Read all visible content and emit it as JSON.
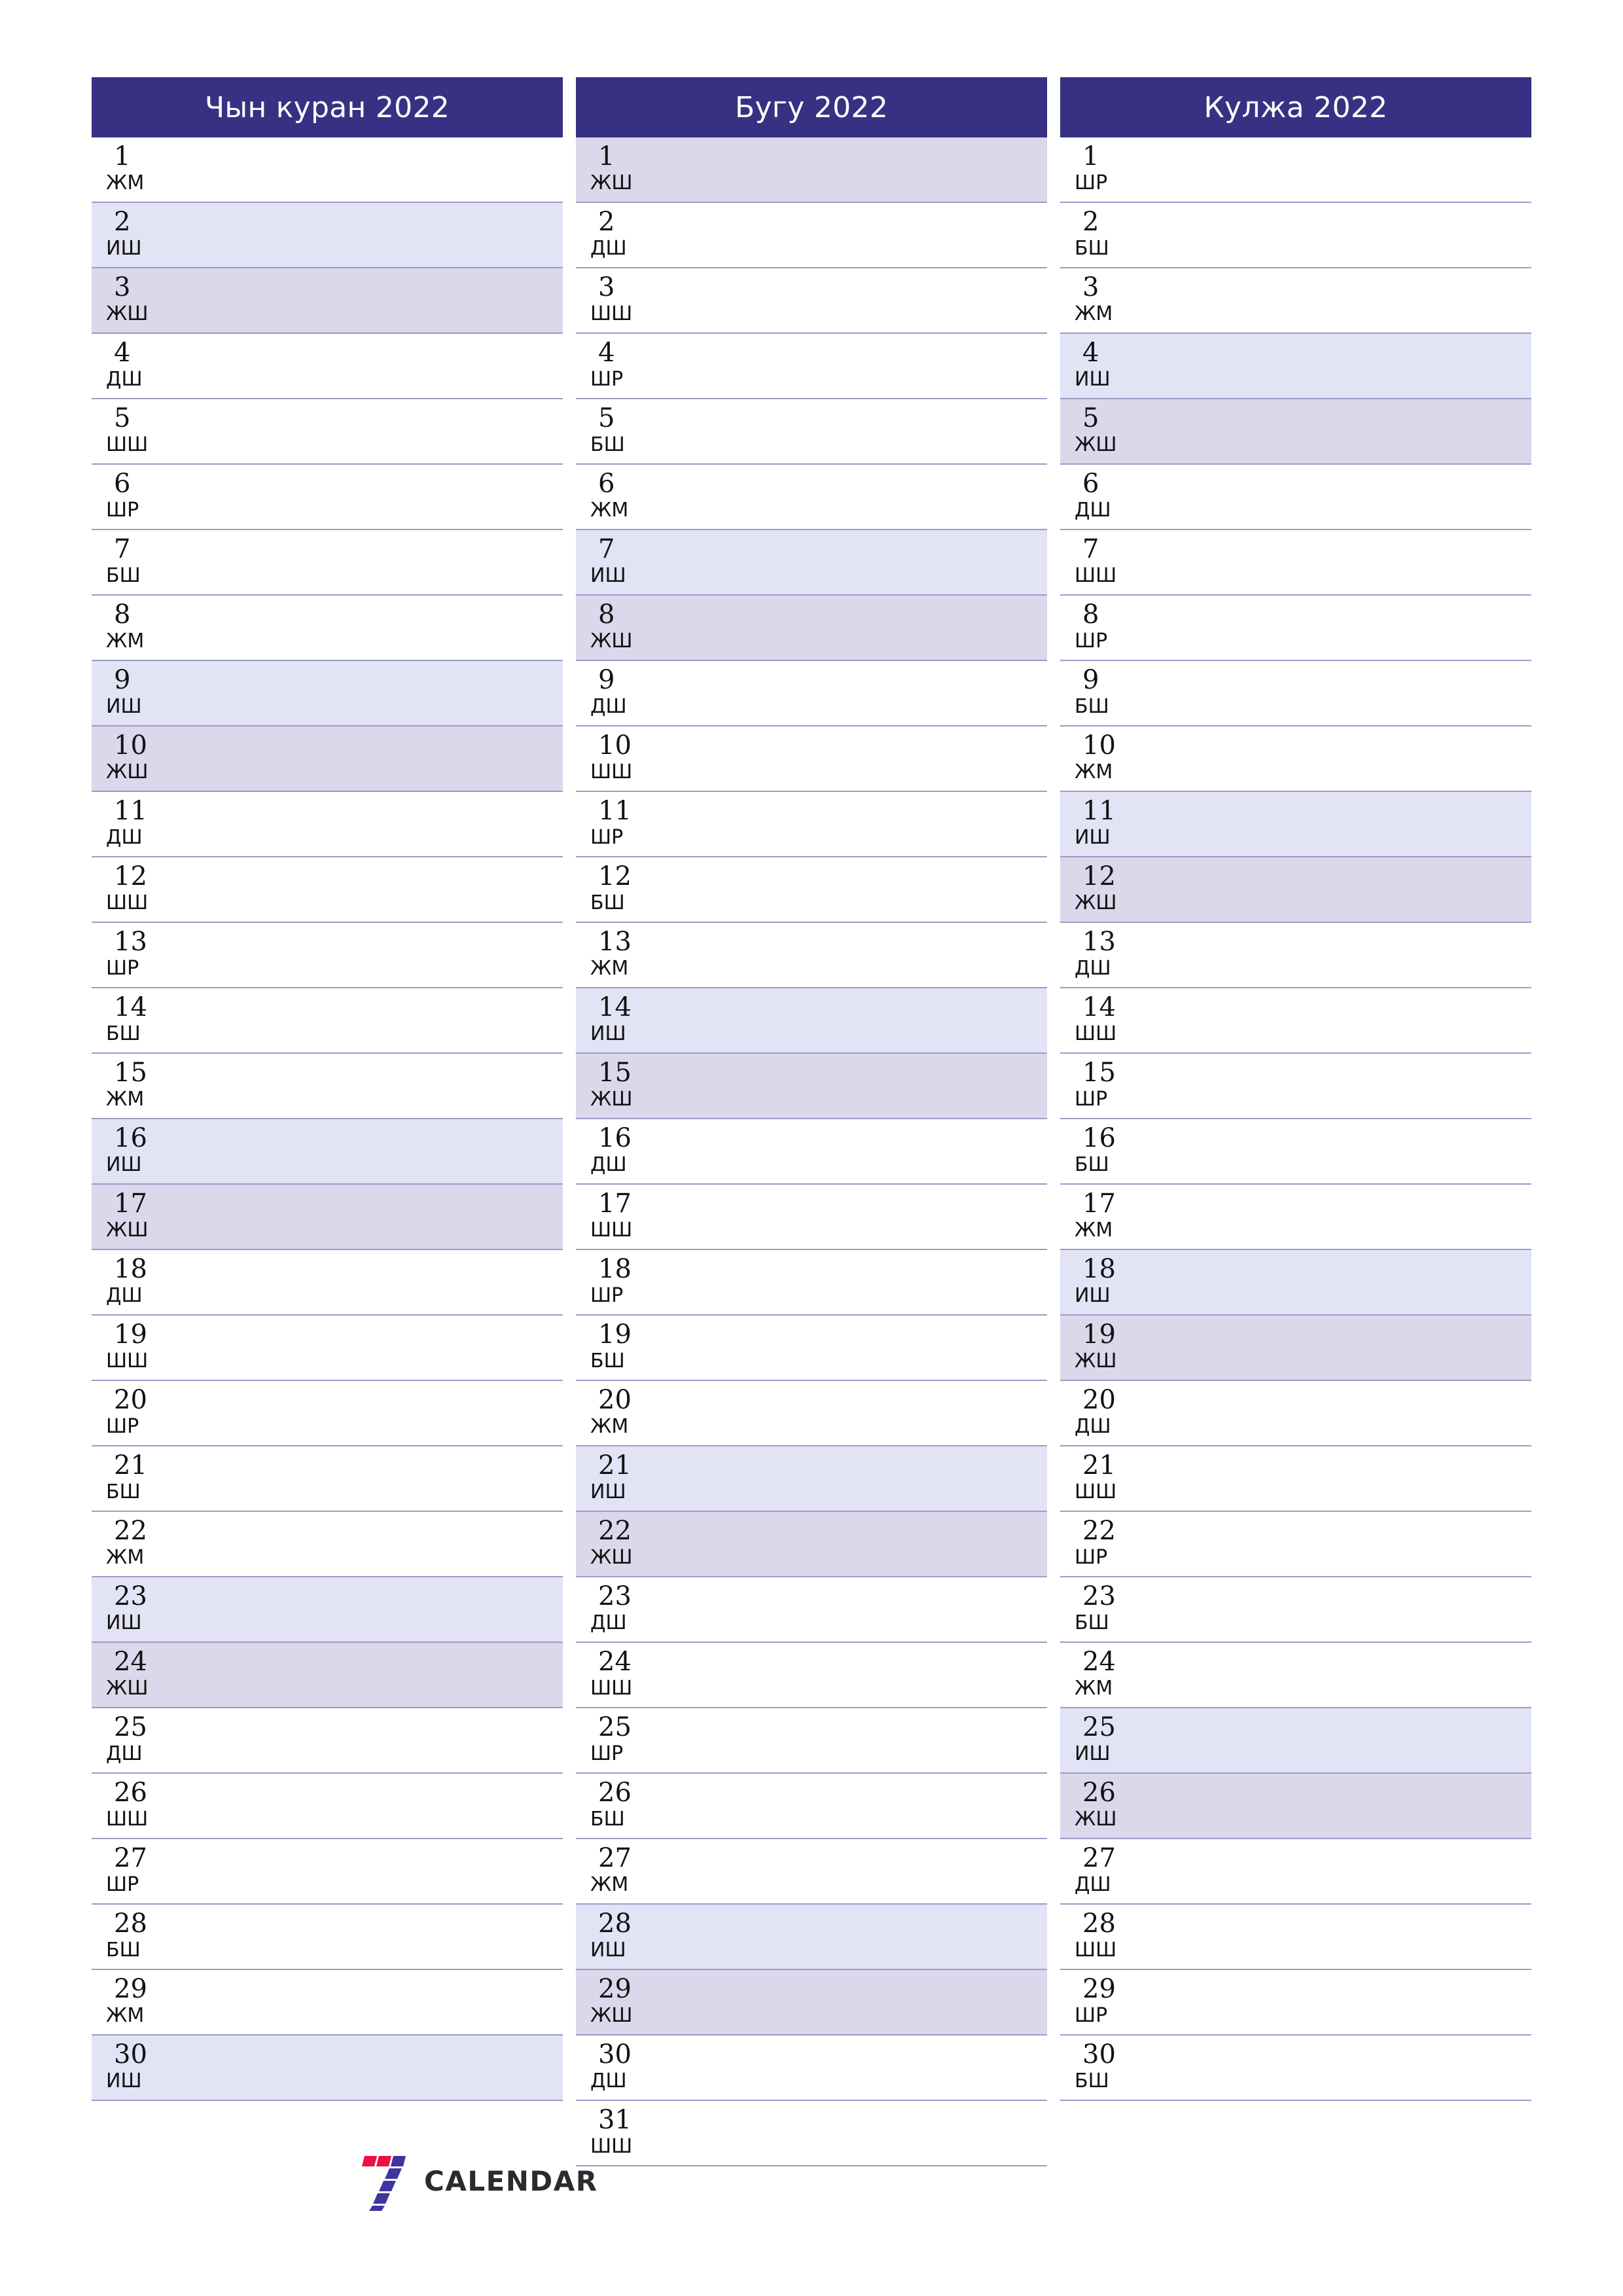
{
  "colors": {
    "header_bg": "#383183",
    "header_text": "#ffffff",
    "sunday_bg": "#e2e3f5",
    "saturday_bg": "#dcd7ea",
    "row_border": "#9e9ac8",
    "page_bg": "#ffffff",
    "logo_red": "#ee0f45",
    "logo_purple": "#3f34a0",
    "logo_text": "#2b2b2f"
  },
  "logo": {
    "wordmark": "CALENDAR",
    "mark_name": "seven-logo-mark"
  },
  "months": [
    {
      "title": "Чын куран 2022",
      "days": [
        {
          "num": "1",
          "weekday": "ЖМ",
          "type": "weekday"
        },
        {
          "num": "2",
          "weekday": "ИШ",
          "type": "sunday"
        },
        {
          "num": "3",
          "weekday": "ЖШ",
          "type": "saturday"
        },
        {
          "num": "4",
          "weekday": "ДШ",
          "type": "weekday"
        },
        {
          "num": "5",
          "weekday": "ШШ",
          "type": "weekday"
        },
        {
          "num": "6",
          "weekday": "ШР",
          "type": "weekday"
        },
        {
          "num": "7",
          "weekday": "БШ",
          "type": "weekday"
        },
        {
          "num": "8",
          "weekday": "ЖМ",
          "type": "weekday"
        },
        {
          "num": "9",
          "weekday": "ИШ",
          "type": "sunday"
        },
        {
          "num": "10",
          "weekday": "ЖШ",
          "type": "saturday"
        },
        {
          "num": "11",
          "weekday": "ДШ",
          "type": "weekday"
        },
        {
          "num": "12",
          "weekday": "ШШ",
          "type": "weekday"
        },
        {
          "num": "13",
          "weekday": "ШР",
          "type": "weekday"
        },
        {
          "num": "14",
          "weekday": "БШ",
          "type": "weekday"
        },
        {
          "num": "15",
          "weekday": "ЖМ",
          "type": "weekday"
        },
        {
          "num": "16",
          "weekday": "ИШ",
          "type": "sunday"
        },
        {
          "num": "17",
          "weekday": "ЖШ",
          "type": "saturday"
        },
        {
          "num": "18",
          "weekday": "ДШ",
          "type": "weekday"
        },
        {
          "num": "19",
          "weekday": "ШШ",
          "type": "weekday"
        },
        {
          "num": "20",
          "weekday": "ШР",
          "type": "weekday"
        },
        {
          "num": "21",
          "weekday": "БШ",
          "type": "weekday"
        },
        {
          "num": "22",
          "weekday": "ЖМ",
          "type": "weekday"
        },
        {
          "num": "23",
          "weekday": "ИШ",
          "type": "sunday"
        },
        {
          "num": "24",
          "weekday": "ЖШ",
          "type": "saturday"
        },
        {
          "num": "25",
          "weekday": "ДШ",
          "type": "weekday"
        },
        {
          "num": "26",
          "weekday": "ШШ",
          "type": "weekday"
        },
        {
          "num": "27",
          "weekday": "ШР",
          "type": "weekday"
        },
        {
          "num": "28",
          "weekday": "БШ",
          "type": "weekday"
        },
        {
          "num": "29",
          "weekday": "ЖМ",
          "type": "weekday"
        },
        {
          "num": "30",
          "weekday": "ИШ",
          "type": "sunday"
        }
      ]
    },
    {
      "title": "Бугу 2022",
      "days": [
        {
          "num": "1",
          "weekday": "ЖШ",
          "type": "saturday"
        },
        {
          "num": "2",
          "weekday": "ДШ",
          "type": "weekday"
        },
        {
          "num": "3",
          "weekday": "ШШ",
          "type": "weekday"
        },
        {
          "num": "4",
          "weekday": "ШР",
          "type": "weekday"
        },
        {
          "num": "5",
          "weekday": "БШ",
          "type": "weekday"
        },
        {
          "num": "6",
          "weekday": "ЖМ",
          "type": "weekday"
        },
        {
          "num": "7",
          "weekday": "ИШ",
          "type": "sunday"
        },
        {
          "num": "8",
          "weekday": "ЖШ",
          "type": "saturday"
        },
        {
          "num": "9",
          "weekday": "ДШ",
          "type": "weekday"
        },
        {
          "num": "10",
          "weekday": "ШШ",
          "type": "weekday"
        },
        {
          "num": "11",
          "weekday": "ШР",
          "type": "weekday"
        },
        {
          "num": "12",
          "weekday": "БШ",
          "type": "weekday"
        },
        {
          "num": "13",
          "weekday": "ЖМ",
          "type": "weekday"
        },
        {
          "num": "14",
          "weekday": "ИШ",
          "type": "sunday"
        },
        {
          "num": "15",
          "weekday": "ЖШ",
          "type": "saturday"
        },
        {
          "num": "16",
          "weekday": "ДШ",
          "type": "weekday"
        },
        {
          "num": "17",
          "weekday": "ШШ",
          "type": "weekday"
        },
        {
          "num": "18",
          "weekday": "ШР",
          "type": "weekday"
        },
        {
          "num": "19",
          "weekday": "БШ",
          "type": "weekday"
        },
        {
          "num": "20",
          "weekday": "ЖМ",
          "type": "weekday"
        },
        {
          "num": "21",
          "weekday": "ИШ",
          "type": "sunday"
        },
        {
          "num": "22",
          "weekday": "ЖШ",
          "type": "saturday"
        },
        {
          "num": "23",
          "weekday": "ДШ",
          "type": "weekday"
        },
        {
          "num": "24",
          "weekday": "ШШ",
          "type": "weekday"
        },
        {
          "num": "25",
          "weekday": "ШР",
          "type": "weekday"
        },
        {
          "num": "26",
          "weekday": "БШ",
          "type": "weekday"
        },
        {
          "num": "27",
          "weekday": "ЖМ",
          "type": "weekday"
        },
        {
          "num": "28",
          "weekday": "ИШ",
          "type": "sunday"
        },
        {
          "num": "29",
          "weekday": "ЖШ",
          "type": "saturday"
        },
        {
          "num": "30",
          "weekday": "ДШ",
          "type": "weekday"
        },
        {
          "num": "31",
          "weekday": "ШШ",
          "type": "weekday"
        }
      ]
    },
    {
      "title": "Кулжа 2022",
      "days": [
        {
          "num": "1",
          "weekday": "ШР",
          "type": "weekday"
        },
        {
          "num": "2",
          "weekday": "БШ",
          "type": "weekday"
        },
        {
          "num": "3",
          "weekday": "ЖМ",
          "type": "weekday"
        },
        {
          "num": "4",
          "weekday": "ИШ",
          "type": "sunday"
        },
        {
          "num": "5",
          "weekday": "ЖШ",
          "type": "saturday"
        },
        {
          "num": "6",
          "weekday": "ДШ",
          "type": "weekday"
        },
        {
          "num": "7",
          "weekday": "ШШ",
          "type": "weekday"
        },
        {
          "num": "8",
          "weekday": "ШР",
          "type": "weekday"
        },
        {
          "num": "9",
          "weekday": "БШ",
          "type": "weekday"
        },
        {
          "num": "10",
          "weekday": "ЖМ",
          "type": "weekday"
        },
        {
          "num": "11",
          "weekday": "ИШ",
          "type": "sunday"
        },
        {
          "num": "12",
          "weekday": "ЖШ",
          "type": "saturday"
        },
        {
          "num": "13",
          "weekday": "ДШ",
          "type": "weekday"
        },
        {
          "num": "14",
          "weekday": "ШШ",
          "type": "weekday"
        },
        {
          "num": "15",
          "weekday": "ШР",
          "type": "weekday"
        },
        {
          "num": "16",
          "weekday": "БШ",
          "type": "weekday"
        },
        {
          "num": "17",
          "weekday": "ЖМ",
          "type": "weekday"
        },
        {
          "num": "18",
          "weekday": "ИШ",
          "type": "sunday"
        },
        {
          "num": "19",
          "weekday": "ЖШ",
          "type": "saturday"
        },
        {
          "num": "20",
          "weekday": "ДШ",
          "type": "weekday"
        },
        {
          "num": "21",
          "weekday": "ШШ",
          "type": "weekday"
        },
        {
          "num": "22",
          "weekday": "ШР",
          "type": "weekday"
        },
        {
          "num": "23",
          "weekday": "БШ",
          "type": "weekday"
        },
        {
          "num": "24",
          "weekday": "ЖМ",
          "type": "weekday"
        },
        {
          "num": "25",
          "weekday": "ИШ",
          "type": "sunday"
        },
        {
          "num": "26",
          "weekday": "ЖШ",
          "type": "saturday"
        },
        {
          "num": "27",
          "weekday": "ДШ",
          "type": "weekday"
        },
        {
          "num": "28",
          "weekday": "ШШ",
          "type": "weekday"
        },
        {
          "num": "29",
          "weekday": "ШР",
          "type": "weekday"
        },
        {
          "num": "30",
          "weekday": "БШ",
          "type": "weekday"
        }
      ]
    }
  ]
}
